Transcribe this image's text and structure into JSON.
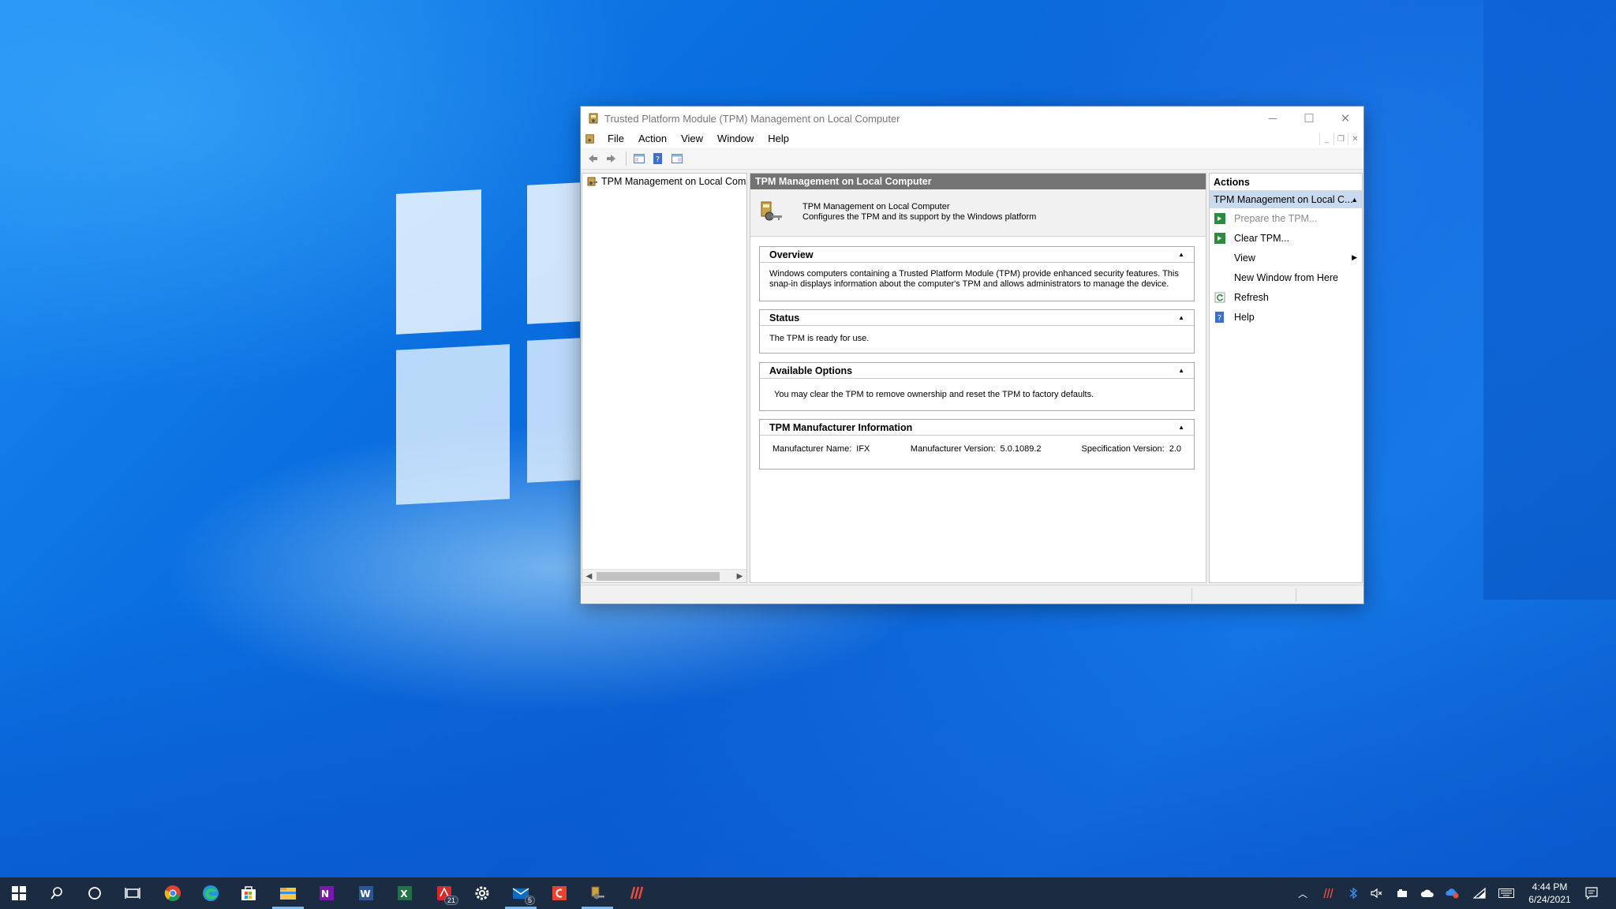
{
  "window": {
    "title": "Trusted Platform Module (TPM) Management on Local Computer",
    "controls": {
      "minimize": "─",
      "maximize": "☐",
      "close": "✕"
    }
  },
  "menubar": {
    "items": [
      "File",
      "Action",
      "View",
      "Window",
      "Help"
    ],
    "mdi_controls": {
      "minimize": "_",
      "restore": "❐",
      "close": "✕"
    }
  },
  "toolbar": {
    "buttons": [
      "back-icon",
      "forward-icon",
      "show-hide-console-tree-icon",
      "help-icon",
      "show-hide-action-pane-icon"
    ]
  },
  "tree": {
    "item_label": "TPM Management on Local Comp"
  },
  "center": {
    "header": "TPM Management on Local Computer",
    "intro_line1": "TPM Management on Local Computer",
    "intro_line2": "Configures the TPM and its support by the Windows platform",
    "sections": {
      "overview": {
        "title": "Overview",
        "text_line1": "Windows computers containing a Trusted Platform Module (TPM) provide enhanced security features. This",
        "text_line2": "snap-in displays information about the computer's TPM and allows administrators to manage the device."
      },
      "status": {
        "title": "Status",
        "text": "The TPM is ready for use."
      },
      "options": {
        "title": "Available Options",
        "text": "You may clear the TPM to remove ownership and reset the TPM to factory defaults."
      },
      "manufacturer": {
        "title": "TPM Manufacturer Information",
        "name_label": "Manufacturer Name:",
        "name_value": "IFX",
        "version_label": "Manufacturer Version:",
        "version_value": "5.0.1089.2",
        "spec_label": "Specification Version:",
        "spec_value": "2.0"
      }
    }
  },
  "actions": {
    "header": "Actions",
    "group_label": "TPM Management on Local C...",
    "items": [
      {
        "label": "Prepare the TPM...",
        "icon": "green-arrow-icon",
        "enabled": false
      },
      {
        "label": "Clear TPM...",
        "icon": "green-arrow-icon",
        "enabled": true
      },
      {
        "label": "View",
        "icon": "",
        "enabled": true,
        "submenu": true
      },
      {
        "label": "New Window from Here",
        "icon": "",
        "enabled": true
      },
      {
        "label": "Refresh",
        "icon": "refresh-icon",
        "enabled": true
      },
      {
        "label": "Help",
        "icon": "help-icon",
        "enabled": true
      }
    ]
  },
  "taskbar": {
    "apps": [
      "start-icon",
      "search-icon",
      "cortana-icon",
      "task-view-icon",
      "chrome-icon",
      "edge-icon",
      "store-icon",
      "file-explorer-icon",
      "onenote-icon",
      "word-icon",
      "excel-icon",
      "acrobat-icon",
      "settings-icon",
      "mail-icon",
      "app-red-icon",
      "tpm-app-icon",
      "winrar-icon"
    ],
    "badges": {
      "acrobat": "21",
      "mail": "5"
    },
    "clock_time": "4:44 PM",
    "clock_date": "6/24/2021"
  },
  "colors": {
    "center_header_bg": "#737373",
    "action_group_bg": "#c9d9ee",
    "taskbar_bg": "#1b2b41",
    "active_indicator": "#7db8f0"
  }
}
